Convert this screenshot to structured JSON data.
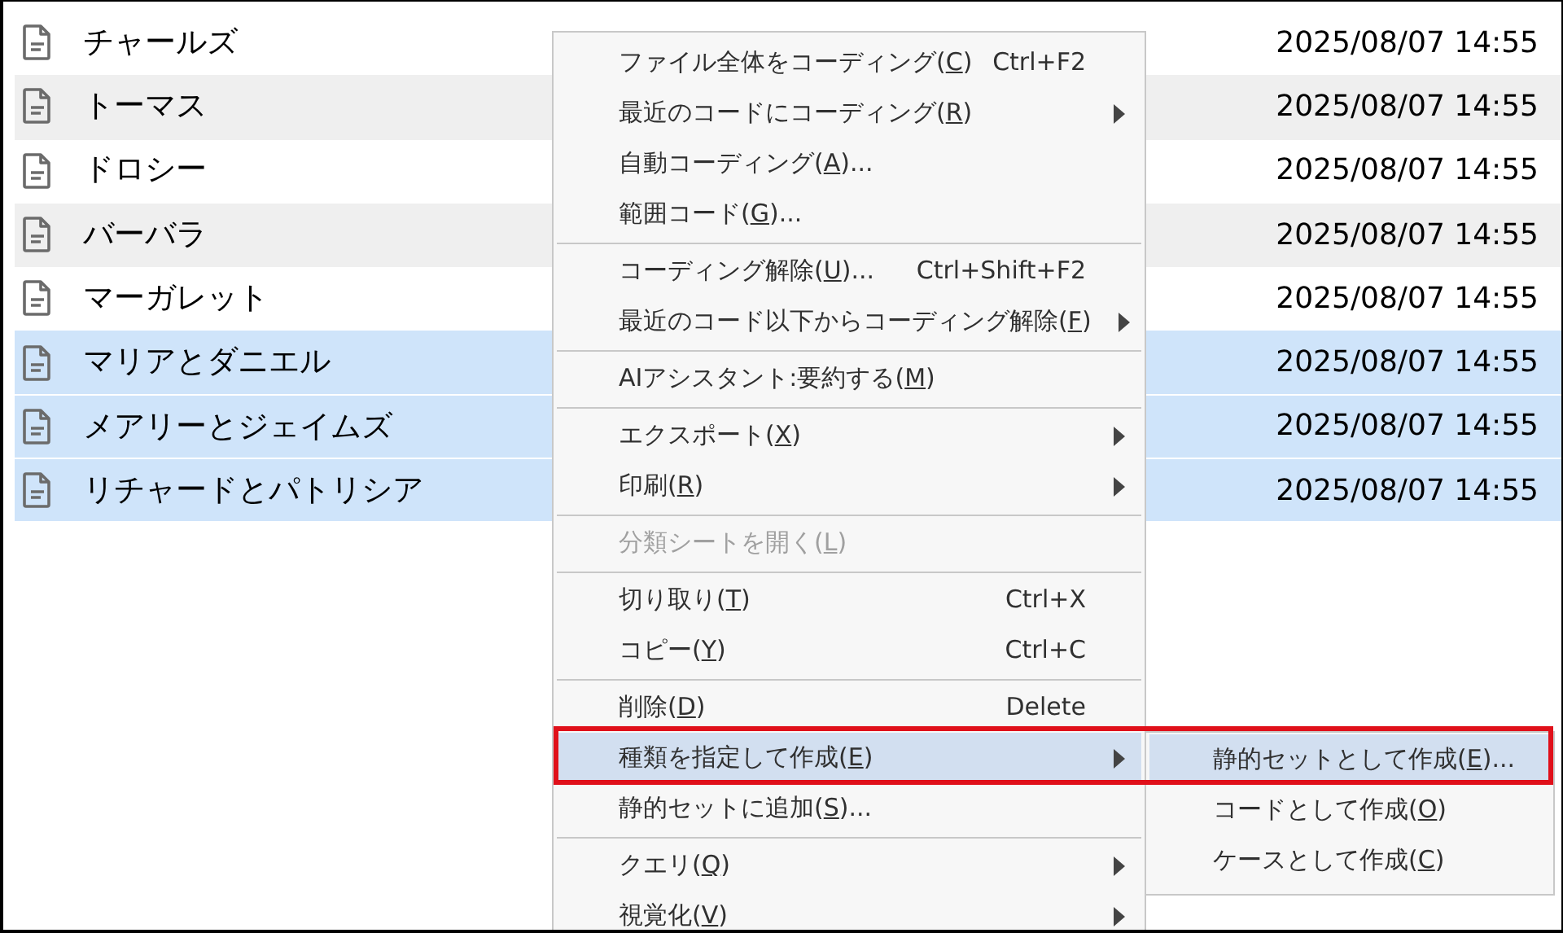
{
  "files": [
    {
      "name": "チャールズ",
      "date": "2025/08/07 14:55",
      "selected": false
    },
    {
      "name": "トーマス",
      "date": "2025/08/07 14:55",
      "selected": false
    },
    {
      "name": "ドロシー",
      "date": "2025/08/07 14:55",
      "selected": false
    },
    {
      "name": "バーバラ",
      "date": "2025/08/07 14:55",
      "selected": false
    },
    {
      "name": "マーガレット",
      "date": "2025/08/07 14:55",
      "selected": false
    },
    {
      "name": "マリアとダニエル",
      "date": "2025/08/07 14:55",
      "selected": true
    },
    {
      "name": "メアリーとジェイムズ",
      "date": "2025/08/07 14:55",
      "selected": true
    },
    {
      "name": "リチャードとパトリシア",
      "date": "2025/08/07 14:55",
      "selected": true
    }
  ],
  "context_menu": {
    "groups": [
      [
        {
          "label": "ファイル全体をコーディング(C)",
          "shortcut": "Ctrl+F2",
          "submenu": false,
          "disabled": false,
          "selected": false
        },
        {
          "label": "最近のコードにコーディング(R)",
          "submenu": true,
          "disabled": false,
          "selected": false
        },
        {
          "label": "自動コーディング(A)...",
          "submenu": false,
          "disabled": false,
          "selected": false
        },
        {
          "label": "範囲コード(G)...",
          "submenu": false,
          "disabled": false,
          "selected": false
        }
      ],
      [
        {
          "label": "コーディング解除(U)...",
          "shortcut": "Ctrl+Shift+F2",
          "submenu": false,
          "disabled": false,
          "selected": false
        },
        {
          "label": "最近のコード以下からコーディング解除(F)",
          "submenu": true,
          "disabled": false,
          "selected": false
        }
      ],
      [
        {
          "label": "AIアシスタント:要約する(M)",
          "submenu": false,
          "disabled": false,
          "selected": false
        }
      ],
      [
        {
          "label": "エクスポート(X)",
          "submenu": true,
          "disabled": false,
          "selected": false
        },
        {
          "label": "印刷(R)",
          "submenu": true,
          "disabled": false,
          "selected": false
        }
      ],
      [
        {
          "label": "分類シートを開く(L)",
          "submenu": false,
          "disabled": true,
          "selected": false
        }
      ],
      [
        {
          "label": "切り取り(T)",
          "shortcut": "Ctrl+X",
          "submenu": false,
          "disabled": false,
          "selected": false
        },
        {
          "label": "コピー(Y)",
          "shortcut": "Ctrl+C",
          "submenu": false,
          "disabled": false,
          "selected": false
        }
      ],
      [
        {
          "label": "削除(D)",
          "shortcut": "Delete",
          "submenu": false,
          "disabled": false,
          "selected": false
        },
        {
          "label": "種類を指定して作成(E)",
          "submenu": true,
          "disabled": false,
          "selected": true
        },
        {
          "label": "静的セットに追加(S)...",
          "submenu": false,
          "disabled": false,
          "selected": false
        }
      ],
      [
        {
          "label": "クエリ(Q)",
          "submenu": true,
          "disabled": false,
          "selected": false
        },
        {
          "label": "視覚化(V)",
          "submenu": true,
          "disabled": false,
          "selected": false
        }
      ]
    ]
  },
  "submenu": {
    "items": [
      {
        "label": "静的セットとして作成(E)...",
        "selected": true
      },
      {
        "label": "コードとして作成(O)",
        "selected": false
      },
      {
        "label": "ケースとして作成(C)",
        "selected": false
      }
    ]
  }
}
